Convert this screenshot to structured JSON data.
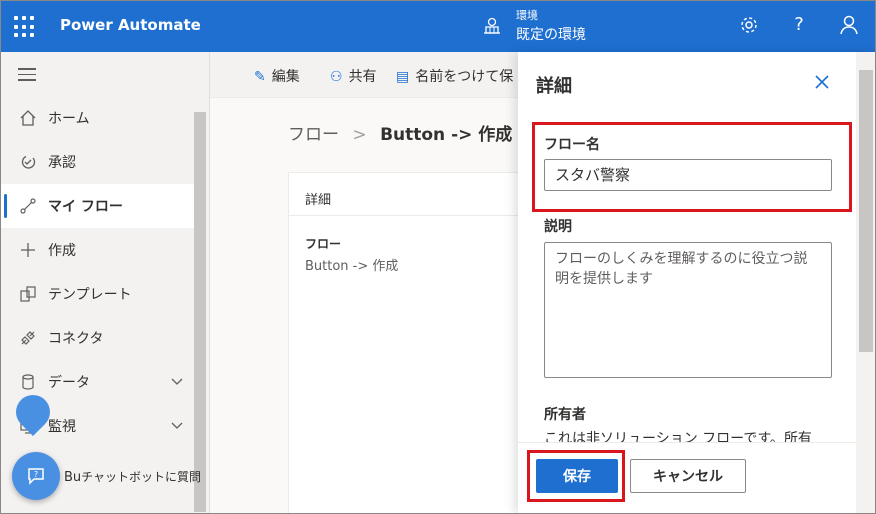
{
  "topbar": {
    "app_title": "Power Automate",
    "env_label": "環境",
    "env_value": "既定の環境",
    "icons": [
      "waffle-icon",
      "environment-icon",
      "gear-icon",
      "help-icon",
      "user-icon"
    ],
    "help_glyph": "?"
  },
  "sidebar": {
    "items": [
      {
        "label": "ホーム",
        "icon": "home-icon"
      },
      {
        "label": "承認",
        "icon": "approvals-icon"
      },
      {
        "label": "マイ フロー",
        "icon": "flow-icon"
      },
      {
        "label": "作成",
        "icon": "plus-icon"
      },
      {
        "label": "テンプレート",
        "icon": "template-icon"
      },
      {
        "label": "コネクタ",
        "icon": "connector-icon"
      },
      {
        "label": "データ",
        "icon": "database-icon"
      },
      {
        "label": "監視",
        "icon": "monitor-icon"
      }
    ],
    "active_index": 2,
    "chatbot_label_prefix": "Bu",
    "chatbot_label": "チャットボットに質問"
  },
  "main": {
    "commands": [
      {
        "label": "編集",
        "icon": "edit-icon"
      },
      {
        "label": "共有",
        "icon": "share-icon"
      },
      {
        "label": "名前をつけて保",
        "icon": "save-as-icon"
      }
    ],
    "breadcrumb_root": "フロー",
    "breadcrumb_sep": ">",
    "breadcrumb_current": "Button -> 作成",
    "card": {
      "header": "詳細",
      "flow_key": "フロー",
      "flow_value": "Button -> 作成"
    }
  },
  "panel": {
    "title": "詳細",
    "flow_name_label": "フロー名",
    "flow_name_value": "スタバ警察",
    "description_label": "説明",
    "description_placeholder": "フローのしくみを理解するのに役立つ説明を提供します",
    "owner_label": "所有者",
    "owner_text": "これは非ソリューション フローです。所有",
    "save_label": "保存",
    "cancel_label": "キャンセル"
  },
  "colors": {
    "accent": "#1e6fd0",
    "highlight": "#d9161e"
  }
}
